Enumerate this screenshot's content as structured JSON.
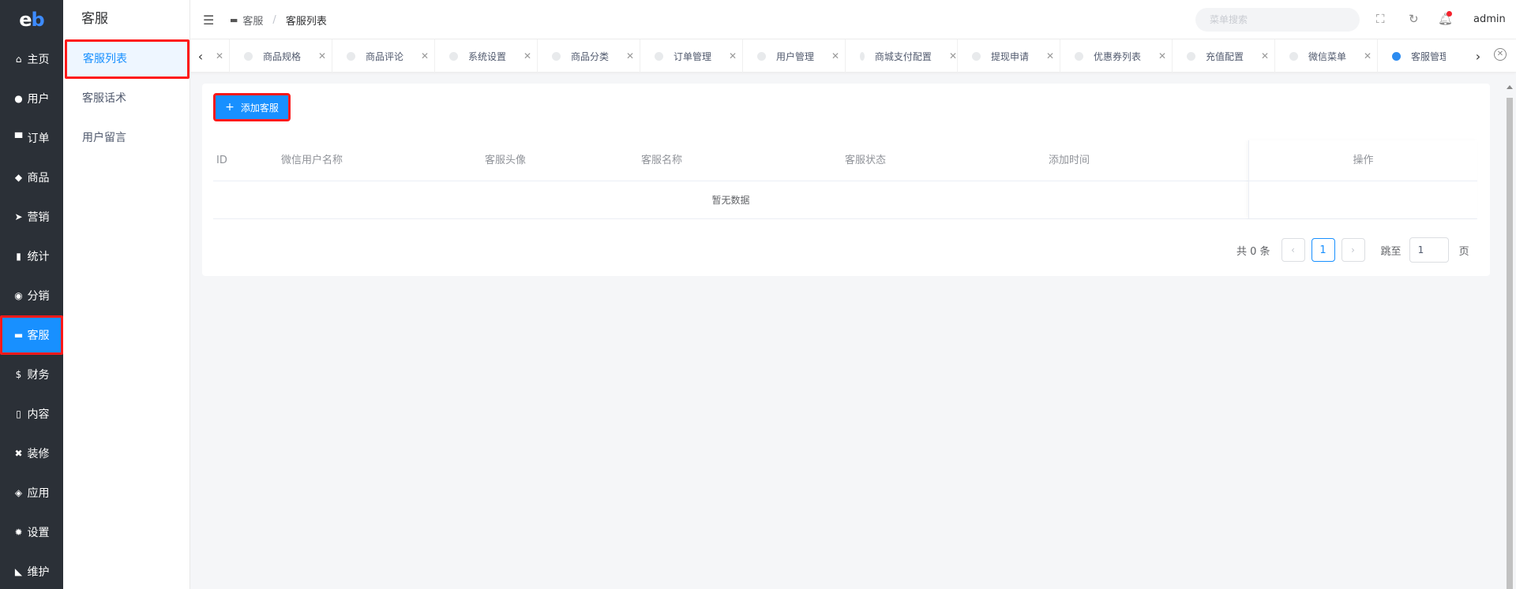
{
  "logo": {
    "e": "e",
    "b": "b"
  },
  "nav": {
    "items": [
      {
        "label": "主页",
        "icon": "⌂",
        "icon_name": "home-icon"
      },
      {
        "label": "用户",
        "icon": "●",
        "icon_name": "user-icon"
      },
      {
        "label": "订单",
        "icon": "▀",
        "icon_name": "cart-icon"
      },
      {
        "label": "商品",
        "icon": "◆",
        "icon_name": "basket-icon"
      },
      {
        "label": "营销",
        "icon": "➤",
        "icon_name": "send-icon"
      },
      {
        "label": "统计",
        "icon": "▮",
        "icon_name": "bar-chart-icon"
      },
      {
        "label": "分销",
        "icon": "◉",
        "icon_name": "handshake-icon"
      },
      {
        "label": "客服",
        "icon": "▬",
        "icon_name": "chat-icon"
      },
      {
        "label": "财务",
        "icon": "$",
        "icon_name": "dollar-icon"
      },
      {
        "label": "内容",
        "icon": "▯",
        "icon_name": "book-icon"
      },
      {
        "label": "装修",
        "icon": "✖",
        "icon_name": "tools-icon"
      },
      {
        "label": "应用",
        "icon": "◈",
        "icon_name": "cube-icon"
      },
      {
        "label": "设置",
        "icon": "✹",
        "icon_name": "gear-icon"
      },
      {
        "label": "维护",
        "icon": "◣",
        "icon_name": "hammer-icon"
      }
    ],
    "active_index": 7
  },
  "submenu": {
    "title": "客服",
    "items": [
      "客服列表",
      "客服话术",
      "用户留言"
    ],
    "active_index": 0
  },
  "header": {
    "breadcrumb": {
      "parent": "客服",
      "current": "客服列表"
    },
    "search_placeholder": "菜单搜索",
    "user": "admin"
  },
  "tabs": {
    "items": [
      "商品规格",
      "商品评论",
      "系统设置",
      "商品分类",
      "订单管理",
      "用户管理",
      "商城支付配置",
      "提现申请",
      "优惠券列表",
      "充值配置",
      "微信菜单",
      "客服管理"
    ],
    "active_index": 11
  },
  "content": {
    "add_button": "添加客服",
    "columns": [
      "ID",
      "微信用户名称",
      "客服头像",
      "客服名称",
      "客服状态",
      "添加时间"
    ],
    "op_column": "操作",
    "empty_text": "暂无数据",
    "pager": {
      "total": "共 0 条",
      "current_page": "1",
      "jump_label": "跳至",
      "jump_value": "1",
      "page_unit": "页"
    }
  },
  "colors": {
    "nav_bg": "#2b3037",
    "primary": "#1890ff",
    "highlight_border": "#ff1a1a",
    "notify_dot": "#f5222d"
  }
}
